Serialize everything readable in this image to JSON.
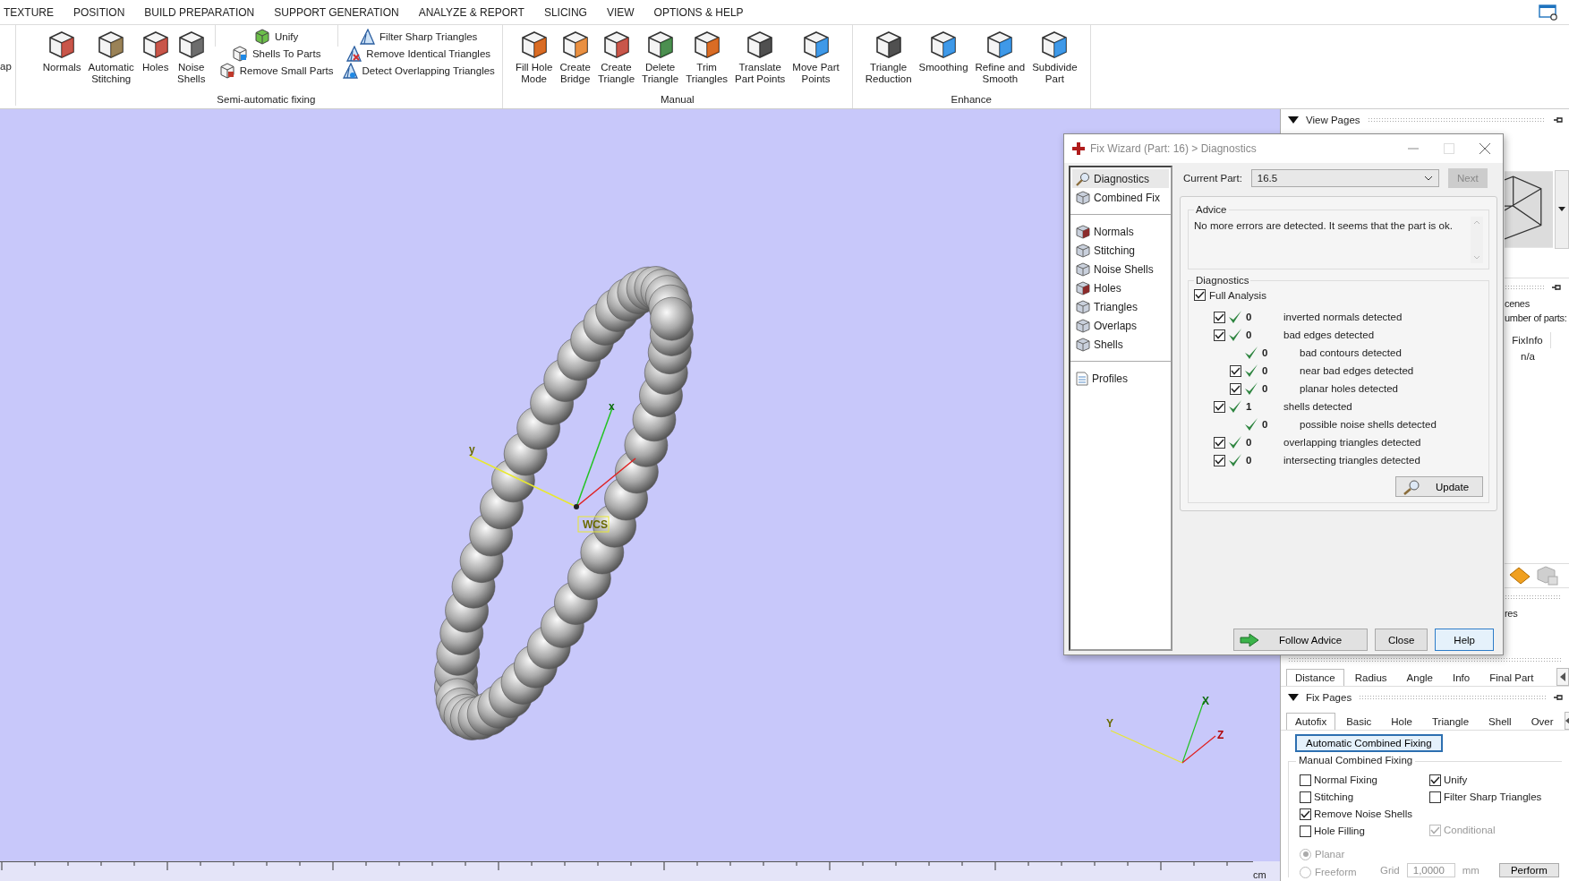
{
  "menu": [
    "TEXTURE",
    "POSITION",
    "BUILD PREPARATION",
    "SUPPORT GENERATION",
    "ANALYZE & REPORT",
    "SLICING",
    "VIEW",
    "OPTIONS & HELP"
  ],
  "ribbon": {
    "cut_button": "ap",
    "groups": [
      {
        "label": "Semi-automatic fixing",
        "sections": [
          {
            "kind": "large",
            "items": [
              "Normals",
              "Automatic\nStitching",
              "Holes",
              "Noise\nShells"
            ]
          },
          {
            "kind": "small",
            "items": [
              "Unify",
              "Shells To Parts",
              "Remove Small Parts"
            ]
          },
          {
            "kind": "small",
            "items": [
              "Filter Sharp Triangles",
              "Remove Identical Triangles",
              "Detect Overlapping Triangles"
            ]
          }
        ]
      },
      {
        "label": "Manual",
        "sections": [
          {
            "kind": "large",
            "items": [
              "Fill Hole\nMode",
              "Create\nBridge",
              "Create\nTriangle",
              "Delete\nTriangle",
              "Trim\nTriangles",
              "Translate\nPart Points",
              "Move Part\nPoints"
            ]
          }
        ]
      },
      {
        "label": "Enhance",
        "sections": [
          {
            "kind": "large",
            "items": [
              "Triangle\nReduction",
              "Smoothing",
              "Refine and\nSmooth",
              "Subdivide\nPart"
            ]
          }
        ]
      }
    ]
  },
  "viewport": {
    "axis_labels": {
      "x": "x",
      "y": "y"
    },
    "wcs": "WCS",
    "triad": {
      "x": "X",
      "y": "Y",
      "z": "Z"
    },
    "ruler_unit": "cm"
  },
  "dialog": {
    "title": "Fix Wizard (Part: 16) > Diagnostics",
    "nav": [
      [
        {
          "label": "Diagnostics",
          "selected": true
        },
        {
          "label": "Combined Fix",
          "selected": false
        }
      ],
      [
        {
          "label": "Normals",
          "selected": false
        },
        {
          "label": "Stitching",
          "selected": false
        },
        {
          "label": "Noise Shells",
          "selected": false
        },
        {
          "label": "Holes",
          "selected": false
        },
        {
          "label": "Triangles",
          "selected": false
        },
        {
          "label": "Overlaps",
          "selected": false
        },
        {
          "label": "Shells",
          "selected": false
        }
      ],
      [
        {
          "label": "Profiles",
          "selected": false
        }
      ]
    ],
    "current_part_label": "Current Part:",
    "current_part": "16.5",
    "next": {
      "label": "Next",
      "disabled": true
    },
    "advice": {
      "title": "Advice",
      "text": "No more errors are detected. It seems that the part is ok."
    },
    "diagnostics": {
      "title": "Diagnostics",
      "full_analysis": {
        "label": "Full Analysis",
        "checked": true
      },
      "rows": [
        {
          "kind": "check",
          "checked": true,
          "count": "0",
          "label": "inverted normals detected"
        },
        {
          "kind": "check",
          "checked": true,
          "count": "0",
          "label": "bad edges detected",
          "children": [
            {
              "kind": "info",
              "count": "0",
              "label": "bad contours detected"
            },
            {
              "kind": "check",
              "checked": true,
              "count": "0",
              "label": "near bad edges detected"
            },
            {
              "kind": "check",
              "checked": true,
              "count": "0",
              "label": "planar holes detected"
            }
          ]
        },
        {
          "kind": "check",
          "checked": true,
          "count": "1",
          "label": "shells detected",
          "children": [
            {
              "kind": "info",
              "count": "0",
              "label": "possible noise shells detected"
            }
          ]
        },
        {
          "kind": "check",
          "checked": true,
          "count": "0",
          "label": "overlapping triangles detected"
        },
        {
          "kind": "check",
          "checked": true,
          "count": "0",
          "label": "intersecting triangles detected"
        }
      ]
    },
    "update": "Update",
    "buttons": [
      {
        "label": "Follow Advice",
        "kind": "arrow"
      },
      {
        "label": "Close",
        "kind": "plain"
      },
      {
        "label": "Help",
        "kind": "default"
      }
    ]
  },
  "side_panel": {
    "view_pages": {
      "title": "View Pages",
      "expanded": true
    },
    "scene_info": [
      "cenes",
      "umber of parts:"
    ],
    "table": {
      "columns": [
        "FixInfo"
      ],
      "rows": [
        [
          "n/a"
        ]
      ]
    },
    "cut_label": "res",
    "measure_tabs": [
      {
        "label": "Distance",
        "selected": true
      },
      {
        "label": "Radius",
        "selected": false
      },
      {
        "label": "Angle",
        "selected": false
      },
      {
        "label": "Info",
        "selected": false
      },
      {
        "label": "Final Part",
        "selected": false
      }
    ],
    "fix_pages": {
      "title": "Fix Pages",
      "expanded": true
    },
    "fix_tabs": [
      {
        "label": "Autofix",
        "selected": true
      },
      {
        "label": "Basic",
        "selected": false
      },
      {
        "label": "Hole",
        "selected": false
      },
      {
        "label": "Triangle",
        "selected": false
      },
      {
        "label": "Shell",
        "selected": false
      },
      {
        "label": "Over",
        "selected": false
      }
    ],
    "auto_button": "Automatic Combined Fixing",
    "manual_group": {
      "title": "Manual Combined Fixing",
      "left_options": [
        {
          "label": "Normal Fixing",
          "checked": false,
          "disabled": false
        },
        {
          "label": "Stitching",
          "checked": false,
          "disabled": false
        },
        {
          "label": "Remove Noise Shells",
          "checked": true,
          "disabled": false
        },
        {
          "label": "Hole Filling",
          "checked": false,
          "disabled": false
        }
      ],
      "right_options": [
        {
          "label": "Unify",
          "checked": true,
          "disabled": false
        },
        {
          "label": "Filter Sharp Triangles",
          "checked": false,
          "disabled": false
        },
        {
          "label": "Conditional",
          "checked": true,
          "disabled": true
        }
      ]
    },
    "radios": [
      {
        "label": "Planar",
        "selected": true,
        "disabled": true
      },
      {
        "label": "Freeform",
        "selected": false,
        "disabled": true
      }
    ],
    "grid": {
      "label": "Grid",
      "value": "1,0000",
      "unit": "mm"
    },
    "perform": "Perform"
  }
}
